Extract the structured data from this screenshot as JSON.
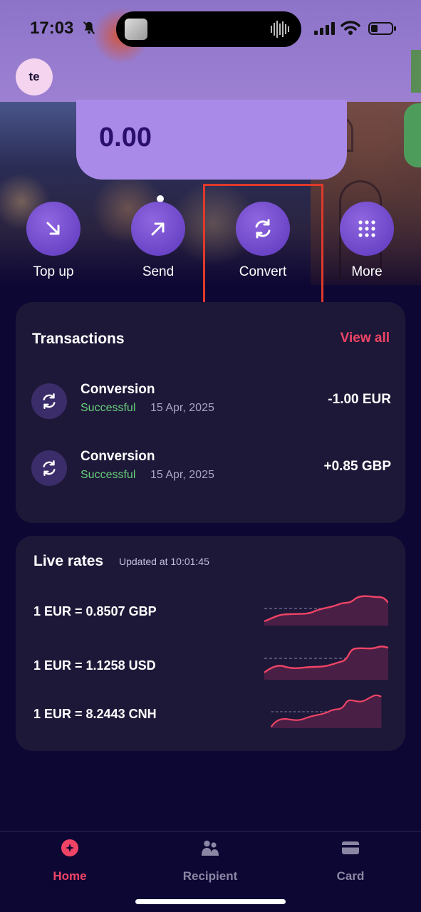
{
  "status_bar": {
    "time": "17:03"
  },
  "profile": {
    "initials": "te"
  },
  "balance": {
    "value": "0.00"
  },
  "actions": [
    {
      "label": "Top up",
      "icon": "arrow-down-right-icon"
    },
    {
      "label": "Send",
      "icon": "arrow-up-right-icon"
    },
    {
      "label": "Convert",
      "icon": "refresh-icon"
    },
    {
      "label": "More",
      "icon": "grid-dots-icon"
    }
  ],
  "transactions": {
    "title": "Transactions",
    "view_all": "View all",
    "items": [
      {
        "name": "Conversion",
        "status": "Successful",
        "date": "15 Apr, 2025",
        "amount": "-1.00 EUR"
      },
      {
        "name": "Conversion",
        "status": "Successful",
        "date": "15 Apr, 2025",
        "amount": "+0.85 GBP"
      }
    ]
  },
  "live_rates": {
    "title": "Live rates",
    "updated": "Updated at 10:01:45",
    "items": [
      {
        "text": "1 EUR = 0.8507 GBP"
      },
      {
        "text": "1 EUR = 1.1258 USD"
      },
      {
        "text": "1 EUR = 8.2443 CNH"
      }
    ]
  },
  "nav": {
    "items": [
      {
        "label": "Home",
        "icon": "home-icon",
        "active": true
      },
      {
        "label": "Recipient",
        "icon": "people-icon",
        "active": false
      },
      {
        "label": "Card",
        "icon": "card-icon",
        "active": false
      }
    ]
  },
  "colors": {
    "background": "#0d0734",
    "card": "#1e1838",
    "accent": "#f04466",
    "success": "#65d07a",
    "action_purple": "#6b45c7",
    "highlight_box": "#e0392b"
  }
}
